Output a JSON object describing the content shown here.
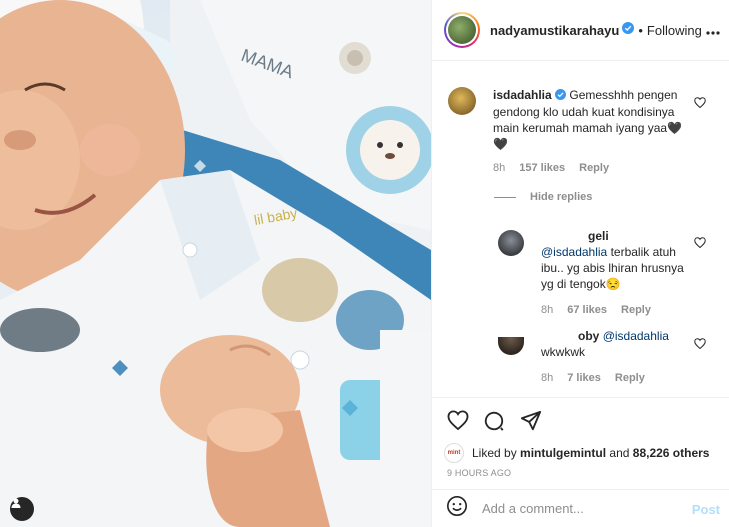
{
  "post": {
    "author": "nadyamustikarahayu",
    "follow_status": "Following",
    "separator": "•"
  },
  "comments": [
    {
      "user": "isdadahlia",
      "verified": true,
      "text": "Gemesshhh pengen gendong klo udah kuat kondisinya main kerumah mamah iyang yaa🖤🖤",
      "time": "8h",
      "likes": "157 likes",
      "reply_label": "Reply",
      "hide_replies_label": "Hide replies",
      "replies": [
        {
          "user": "geli",
          "mention": "@isdadahlia",
          "text": "terbalik atuh ibu.. yg abis lhiran hrusnya yg di tengok😒",
          "time": "8h",
          "likes": "67 likes",
          "reply_label": "Reply"
        },
        {
          "user": "oby",
          "mention": "@isdadahlia",
          "text": "wkwkwk",
          "time": "8h",
          "likes": "7 likes",
          "reply_label": "Reply"
        }
      ]
    }
  ],
  "likes_summary": {
    "prefix": "Liked by",
    "user": "mintulgemintul",
    "joiner": "and",
    "others": "88,226 others"
  },
  "time_ago": "9 HOURS AGO",
  "comment_box": {
    "placeholder": "Add a comment...",
    "post_label": "Post"
  },
  "colors": {
    "verified": "#3897f0",
    "link": "#00376b",
    "post_disabled": "#b2dffc",
    "muted": "#8e8e8e"
  },
  "icons": [
    "user-tag-icon",
    "verified-icon",
    "more-options-icon",
    "heart-icon",
    "comment-icon",
    "share-icon",
    "emoji-icon"
  ]
}
